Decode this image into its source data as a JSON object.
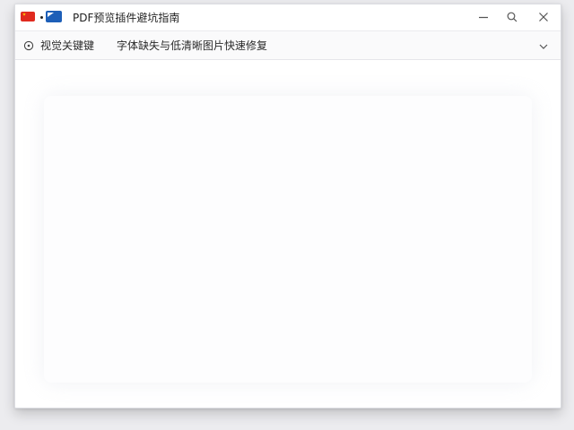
{
  "window": {
    "title": "PDF预览插件避坑指南"
  },
  "titlebar": {
    "icons": [
      "flag-cn-icon",
      "dot-icon",
      "flag-blue-icon"
    ],
    "controls": [
      "minimize-icon",
      "search-icon",
      "close-icon"
    ]
  },
  "tabbar": {
    "icon": "target-icon",
    "label_primary": "视觉关键键",
    "label_secondary": "字体缺失与低清晰图片快速修复",
    "chevron": "chevron-down-icon"
  },
  "colors": {
    "flag_red": "#e02a1f",
    "flag_blue": "#1d5fb8",
    "window_bg": "#ffffff",
    "tabbar_bg": "#fafafb"
  }
}
